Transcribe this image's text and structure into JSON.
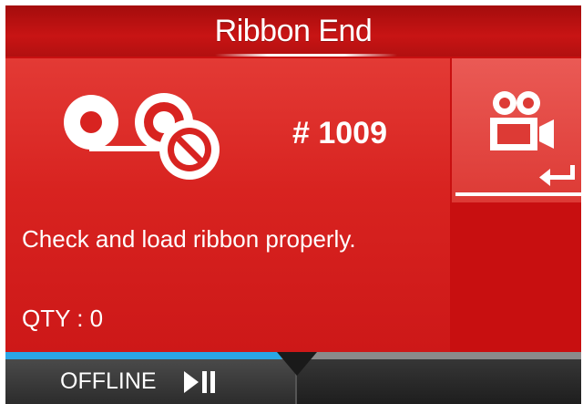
{
  "header": {
    "title": "Ribbon End"
  },
  "error": {
    "code": "# 1009",
    "message": "Check and load ribbon properly.",
    "qty": "QTY : 0"
  },
  "side": {
    "icon": "camera-icon",
    "enter_icon": "enter-arrow-icon"
  },
  "footer": {
    "offline_label": "OFFLINE",
    "play_pause_icon": "play-pause-icon",
    "progress": 0.48
  },
  "colors": {
    "background_red": "#c80f10",
    "panel_red": "#d82320",
    "accent_blue": "#2aa6e6",
    "footer_dark": "#2c2c2c"
  }
}
